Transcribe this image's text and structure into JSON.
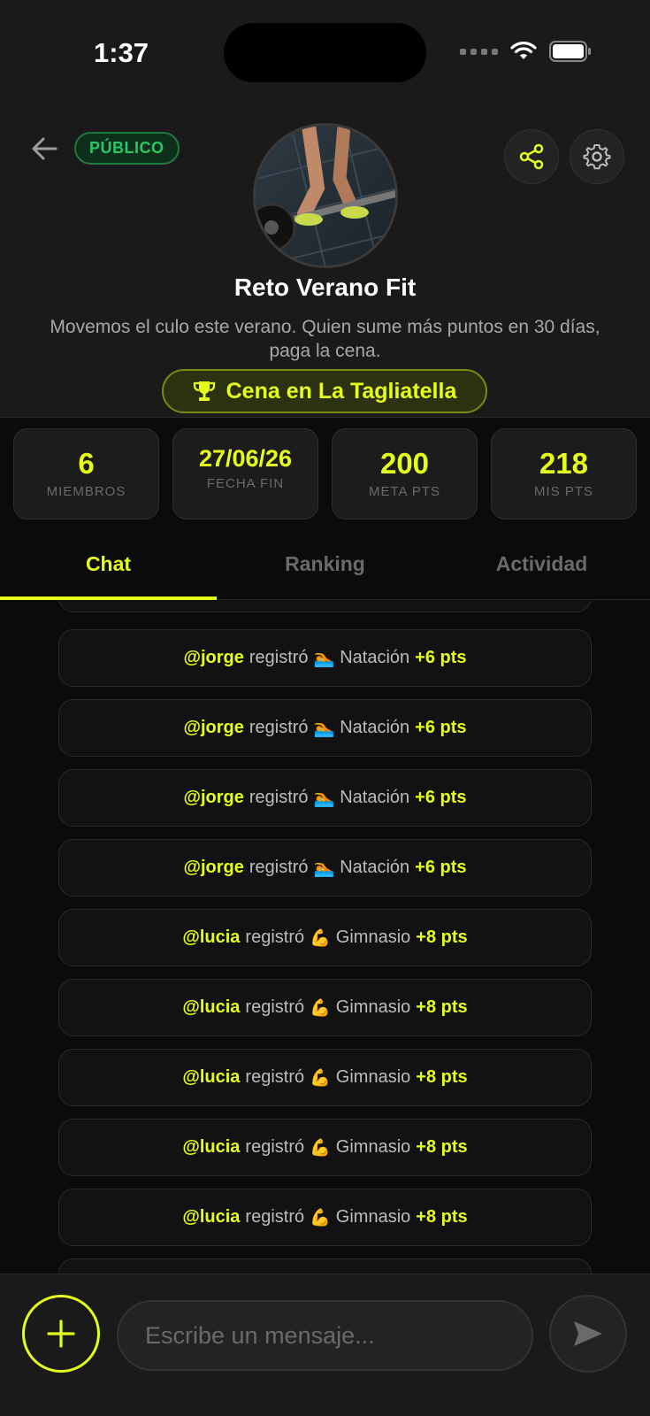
{
  "status": {
    "time": "1:37"
  },
  "header": {
    "visibility_badge": "PÚBLICO",
    "title": "Reto Verano Fit",
    "description": "Movemos el culo este verano. Quien sume más puntos en 30 días, paga la cena.",
    "prize": "Cena en La Tagliatella"
  },
  "stats": [
    {
      "value": "6",
      "label": "MIEMBROS"
    },
    {
      "value": "27/06/26",
      "label": "FECHA FIN"
    },
    {
      "value": "200",
      "label": "META PTS"
    },
    {
      "value": "218",
      "label": "MIS PTS"
    }
  ],
  "tabs": [
    {
      "label": "Chat",
      "active": true
    },
    {
      "label": "Ranking",
      "active": false
    },
    {
      "label": "Actividad",
      "active": false
    }
  ],
  "messages": [
    {
      "user": "@jorge",
      "verb": "registró",
      "emoji": "🏊",
      "activity": "Natación",
      "points": "+6 pts"
    },
    {
      "user": "@jorge",
      "verb": "registró",
      "emoji": "🏊",
      "activity": "Natación",
      "points": "+6 pts"
    },
    {
      "user": "@jorge",
      "verb": "registró",
      "emoji": "🏊",
      "activity": "Natación",
      "points": "+6 pts"
    },
    {
      "user": "@jorge",
      "verb": "registró",
      "emoji": "🏊",
      "activity": "Natación",
      "points": "+6 pts"
    },
    {
      "user": "@lucia",
      "verb": "registró",
      "emoji": "💪",
      "activity": "Gimnasio",
      "points": "+8 pts"
    },
    {
      "user": "@lucia",
      "verb": "registró",
      "emoji": "💪",
      "activity": "Gimnasio",
      "points": "+8 pts"
    },
    {
      "user": "@lucia",
      "verb": "registró",
      "emoji": "💪",
      "activity": "Gimnasio",
      "points": "+8 pts"
    },
    {
      "user": "@lucia",
      "verb": "registró",
      "emoji": "💪",
      "activity": "Gimnasio",
      "points": "+8 pts"
    },
    {
      "user": "@lucia",
      "verb": "registró",
      "emoji": "💪",
      "activity": "Gimnasio",
      "points": "+8 pts"
    }
  ],
  "composer": {
    "placeholder": "Escribe un mensaje..."
  },
  "colors": {
    "accent": "#e6ff1a",
    "public_badge": "#28c767",
    "background": "#0b0b0b",
    "surface": "#1a1a1a"
  },
  "icons": {
    "back": "arrow-left-icon",
    "share": "share-icon",
    "settings": "gear-icon",
    "prize": "trophy-icon",
    "add": "plus-icon",
    "send": "send-icon"
  }
}
